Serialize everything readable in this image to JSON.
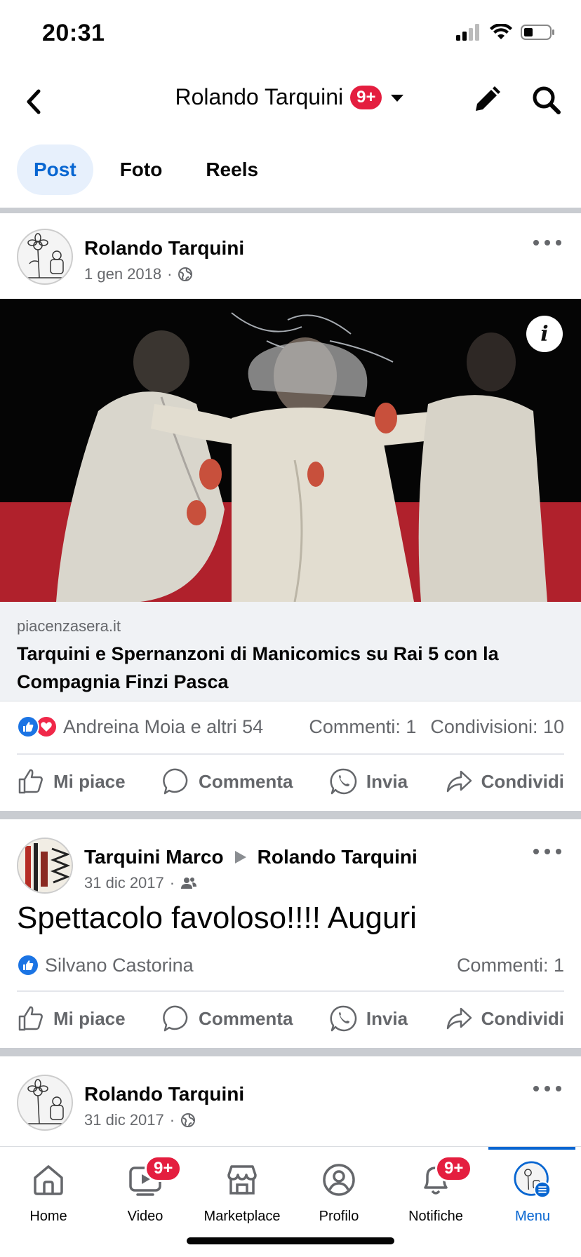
{
  "status_bar": {
    "time": "20:31"
  },
  "header": {
    "title": "Rolando Tarquini",
    "badge": "9+"
  },
  "tabs": [
    {
      "label": "Post",
      "active": true
    },
    {
      "label": "Foto",
      "active": false
    },
    {
      "label": "Reels",
      "active": false
    }
  ],
  "posts": [
    {
      "author": "Rolando Tarquini",
      "date": "1 gen 2018",
      "privacy_icon": "globe-icon",
      "link": {
        "domain": "piacenzasera.it",
        "title": "Tarquini e Spernanzoni di Manicomics su Rai 5 con la Compagnia Finzi Pasca"
      },
      "reactions_text": "Andreina Moia e altri 54",
      "comments": "Commenti: 1",
      "shares": "Condivisioni: 10"
    },
    {
      "author": "Tarquini Marco",
      "target": "Rolando Tarquini",
      "date": "31 dic 2017",
      "privacy_icon": "friends-icon",
      "text": "Spettacolo favoloso!!!!  Auguri",
      "reactions_text": "Silvano Castorina",
      "comments": "Commenti: 1"
    },
    {
      "author": "Rolando Tarquini",
      "date": "31 dic 2017",
      "privacy_icon": "globe-icon"
    }
  ],
  "actions": {
    "like": "Mi piace",
    "comment": "Commenta",
    "send": "Invia",
    "share": "Condividi"
  },
  "bottom_nav": [
    {
      "label": "Home",
      "icon": "home-icon"
    },
    {
      "label": "Video",
      "icon": "video-icon",
      "badge": "9+"
    },
    {
      "label": "Marketplace",
      "icon": "marketplace-icon"
    },
    {
      "label": "Profilo",
      "icon": "profile-icon"
    },
    {
      "label": "Notifiche",
      "icon": "bell-icon",
      "badge": "9+"
    },
    {
      "label": "Menu",
      "icon": "menu-icon",
      "active": true
    }
  ],
  "colors": {
    "accent": "#0866d1",
    "badge": "#e41e3f",
    "like": "#1b74e4",
    "love": "#f02849"
  }
}
